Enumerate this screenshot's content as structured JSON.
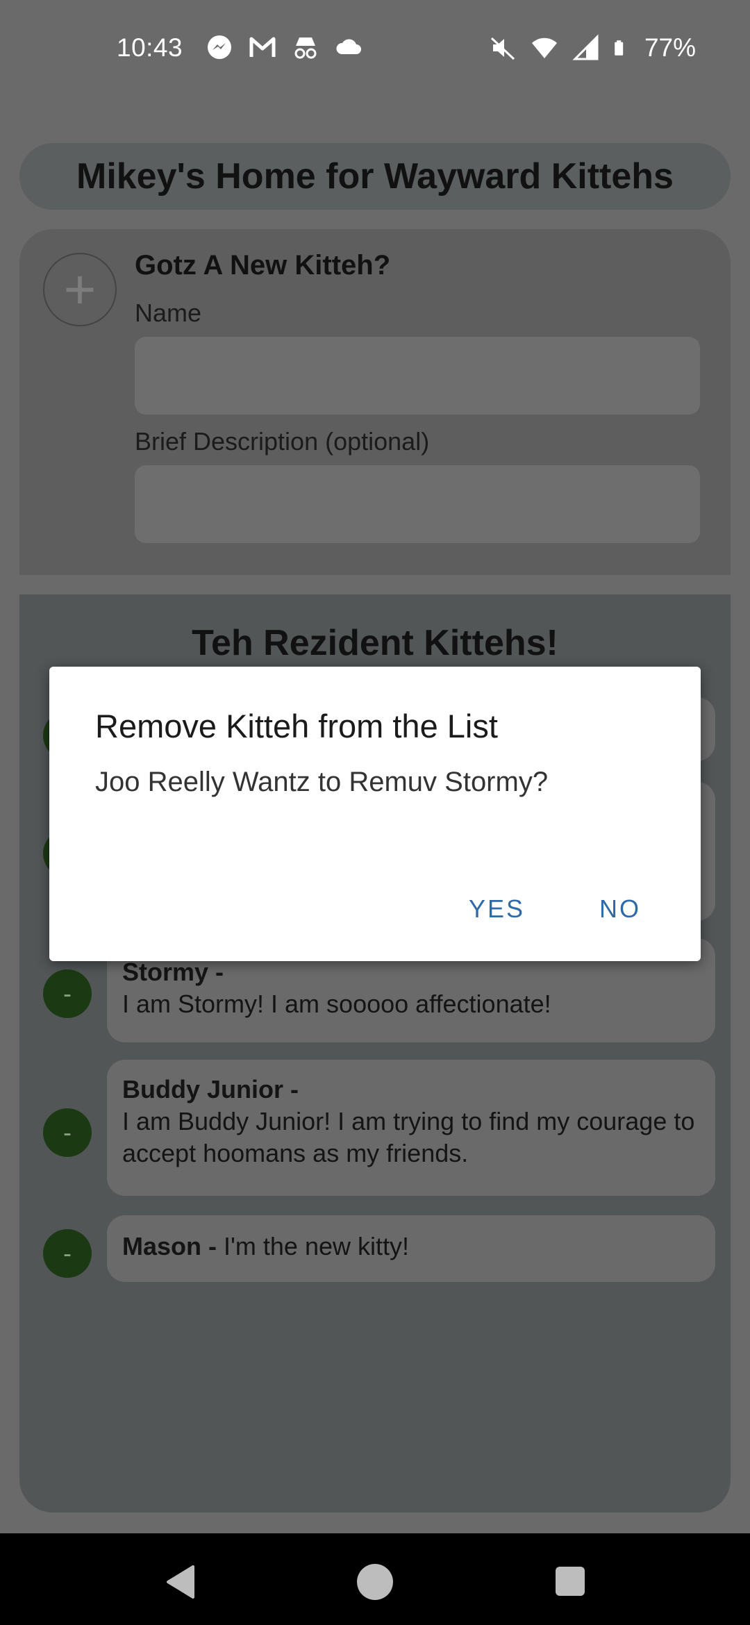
{
  "status_bar": {
    "time": "10:43",
    "battery": "77%",
    "icons_left": [
      "messenger-icon",
      "gmail-icon",
      "incognito-icon",
      "cloud-icon"
    ],
    "icons_right": [
      "mute-icon",
      "wifi-icon",
      "signal-icon",
      "battery-icon"
    ]
  },
  "header": {
    "title": "Mikey's Home for Wayward Kittehs"
  },
  "new_kitteh": {
    "title": "Gotz A New Kitteh?",
    "name_label": "Name",
    "name_value": "",
    "desc_label": "Brief Description (optional)",
    "desc_value": ""
  },
  "residents": {
    "title": "Teh Rezident Kittehs!",
    "items": [
      {
        "name": "Stormy -",
        "desc": "I am Stormy! I am sooooo affectionate!"
      },
      {
        "name": "Buddy Junior -",
        "desc": "I am Buddy Junior! I am trying to find my courage to accept hoomans as my friends."
      },
      {
        "name": "Mason -",
        "desc": "I'm the new kitty!"
      }
    ],
    "remove_label": "-"
  },
  "dialog": {
    "title": "Remove Kitteh from the List",
    "message": "Joo Reelly Wantz to Remuv Stormy?",
    "yes_label": "YES",
    "no_label": "NO"
  },
  "nav": {
    "icons": [
      "back-icon",
      "home-icon",
      "recents-icon"
    ]
  }
}
